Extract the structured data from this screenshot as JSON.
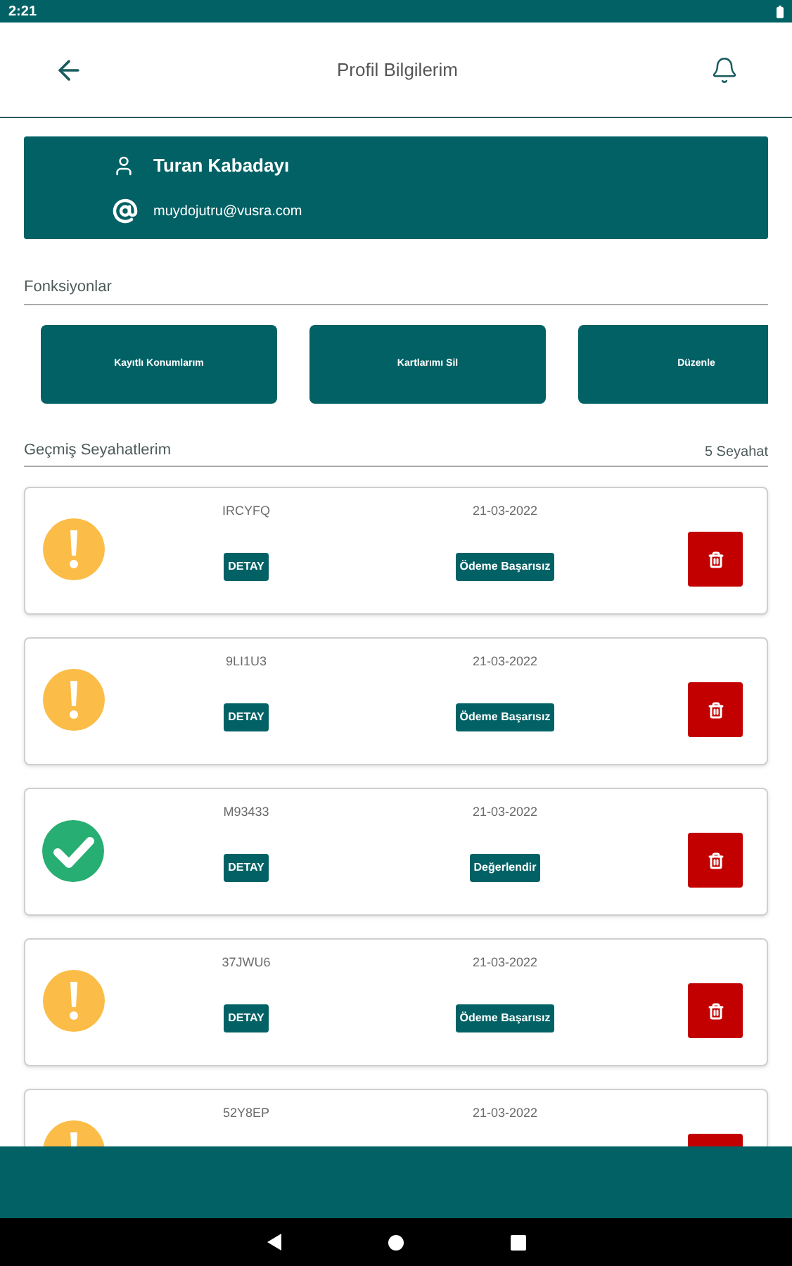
{
  "status_bar": {
    "time": "2:21"
  },
  "header": {
    "title": "Profil Bilgilerim"
  },
  "profile": {
    "name": "Turan Kabadayı",
    "email": "muydojutru@vusra.com"
  },
  "functions": {
    "title": "Fonksiyonlar",
    "buttons": [
      "Kayıtlı Konumlarım",
      "Kartlarımı Sil",
      "Düzenle"
    ]
  },
  "trips": {
    "title": "Geçmiş Seyahatlerim",
    "count": "5 Seyahat",
    "items": [
      {
        "code": "IRCYFQ",
        "date": "21-03-2022",
        "kind": "warning",
        "detail": "DETAY",
        "status": "Ödeme Başarısız"
      },
      {
        "code": "9LI1U3",
        "date": "21-03-2022",
        "kind": "warning",
        "detail": "DETAY",
        "status": "Ödeme Başarısız"
      },
      {
        "code": "M93433",
        "date": "21-03-2022",
        "kind": "success",
        "detail": "DETAY",
        "status": "Değerlendir"
      },
      {
        "code": "37JWU6",
        "date": "21-03-2022",
        "kind": "warning",
        "detail": "DETAY",
        "status": "Ödeme Başarısız"
      },
      {
        "code": "52Y8EP",
        "date": "21-03-2022",
        "kind": "warning"
      }
    ]
  }
}
